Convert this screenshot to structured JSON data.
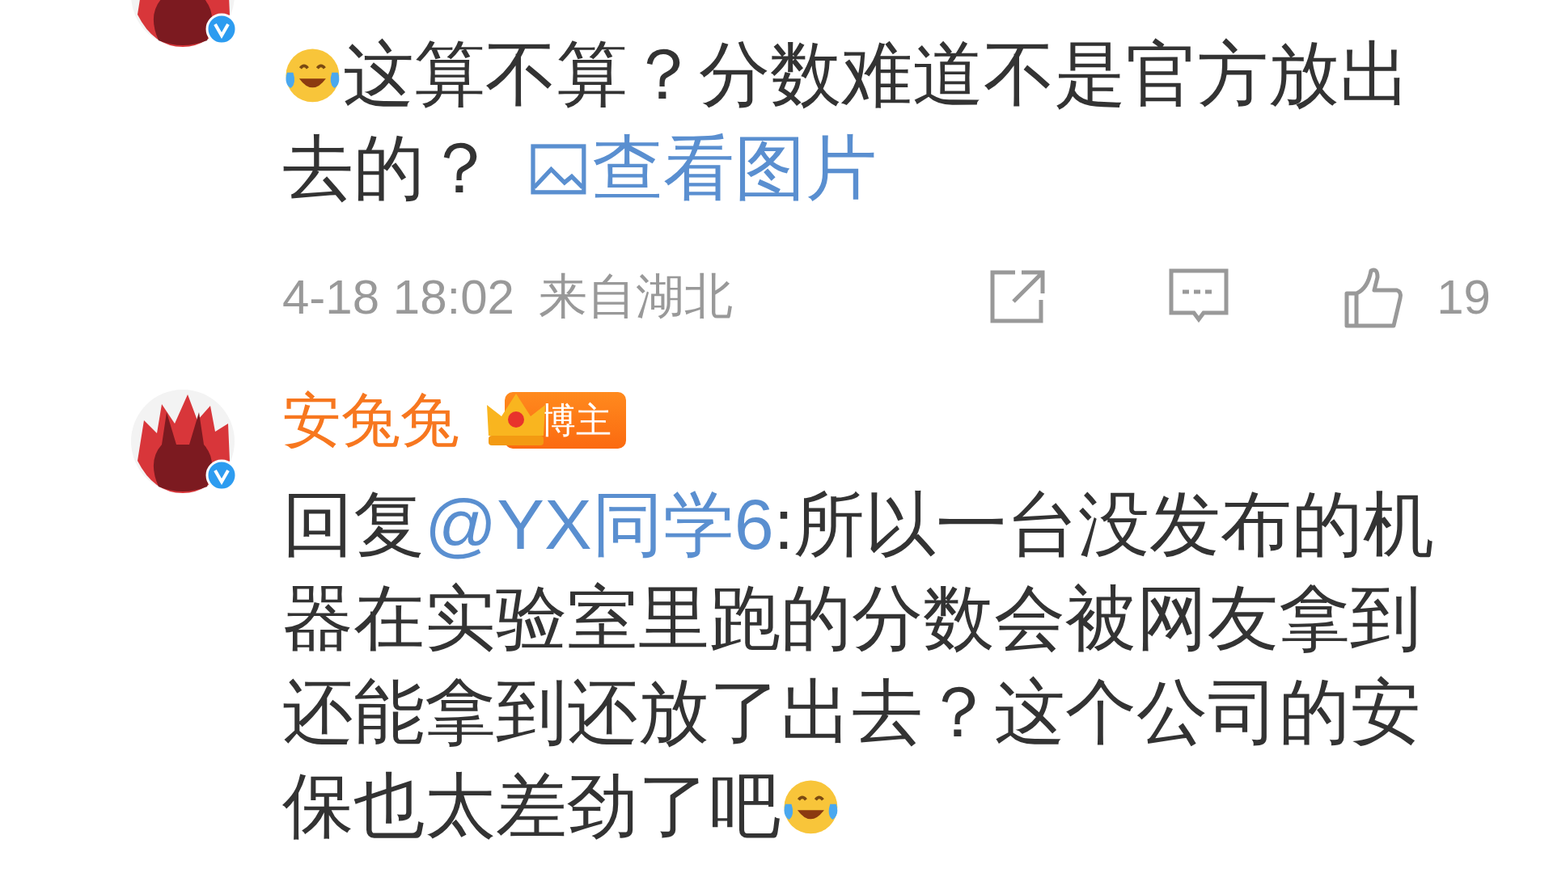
{
  "comments": [
    {
      "verified": true,
      "content": [
        {
          "kind": "emoji"
        },
        {
          "kind": "text",
          "text": "这算不算？分数难道不是官方放出去的？"
        },
        {
          "kind": "link",
          "text": "查看图片"
        }
      ],
      "time": "4-18 18:02",
      "location": "来自湖北",
      "likes": "19"
    },
    {
      "name": "安兔兔",
      "badge": "博主",
      "verified": true,
      "content": [
        {
          "kind": "text",
          "text": "回复"
        },
        {
          "kind": "mention",
          "text": "@YX同学6"
        },
        {
          "kind": "text",
          "text": ":所以一台没发布的机器在实验室里跑的分数会被网友拿到还能拿到还放了出去？这个公司的安保也太差劲了吧"
        },
        {
          "kind": "emoji"
        }
      ]
    }
  ]
}
